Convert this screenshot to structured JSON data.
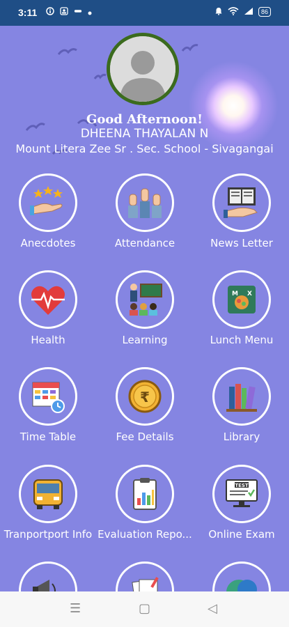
{
  "status_bar": {
    "time": "3:11",
    "battery": "86"
  },
  "header": {
    "greeting": "Good Afternoon!",
    "user_name": "DHEENA THAYALAN N",
    "school": "Mount Litera Zee Sr . Sec. School - Sivagangai"
  },
  "menu": [
    {
      "label": "Anecdotes",
      "icon": "stars-hand-icon"
    },
    {
      "label": "Attendance",
      "icon": "raised-hands-icon"
    },
    {
      "label": "News Letter",
      "icon": "newspaper-hand-icon"
    },
    {
      "label": "Health",
      "icon": "heart-pulse-icon"
    },
    {
      "label": "Learning",
      "icon": "classroom-icon"
    },
    {
      "label": "Lunch Menu",
      "icon": "lunch-menu-icon"
    },
    {
      "label": "Time Table",
      "icon": "calendar-clock-icon"
    },
    {
      "label": "Fee Details",
      "icon": "rupee-coin-icon"
    },
    {
      "label": "Library",
      "icon": "books-icon"
    },
    {
      "label": "Tranportport Info",
      "icon": "school-bus-icon"
    },
    {
      "label": "Evaluation Repo...",
      "icon": "clipboard-chart-icon"
    },
    {
      "label": "Online Exam",
      "icon": "test-monitor-icon"
    },
    {
      "label": "",
      "icon": "megaphone-icon"
    },
    {
      "label": "",
      "icon": "documents-icon"
    },
    {
      "label": "",
      "icon": "chat-bubble-icon"
    }
  ],
  "nav_bar": {
    "menu_glyph": "☰",
    "home_glyph": "▢",
    "back_glyph": "◁"
  }
}
